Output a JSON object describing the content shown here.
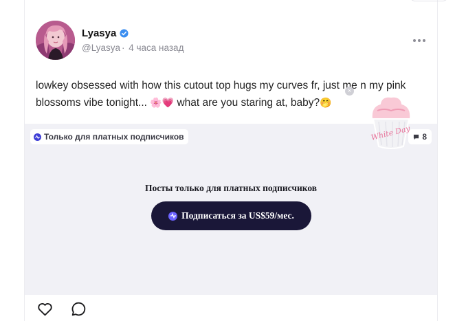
{
  "post": {
    "author_name": "Lyasya",
    "author_handle": "@Lyasya",
    "separator": "·",
    "time_ago": "4 часа назад",
    "text_part1": "lowkey obsessed with how this cutout top hugs my curves fr, just me n my pink blossoms vibe tonight... ",
    "emoji_blossom": "🌸",
    "emoji_heart": "💗",
    "text_part2": " what are you staring at, baby?",
    "emoji_face": "🤭"
  },
  "locked": {
    "badge_label": "Только для платных подписчиков",
    "comment_count": "8",
    "title": "Посты только для платных подписчиков",
    "subscribe_label": "Подписаться за US$59/мес."
  },
  "sticker": {
    "close_symbol": "×",
    "text": "White Day"
  },
  "colors": {
    "accent": "#1a1738",
    "verified": "#3b8ef0",
    "locked_bg": "#f1f1f6"
  },
  "icons": [
    "verified-icon",
    "more-icon",
    "badge-icon",
    "comment-icon",
    "subscribe-icon",
    "heart-icon",
    "comment-bubble-icon"
  ]
}
